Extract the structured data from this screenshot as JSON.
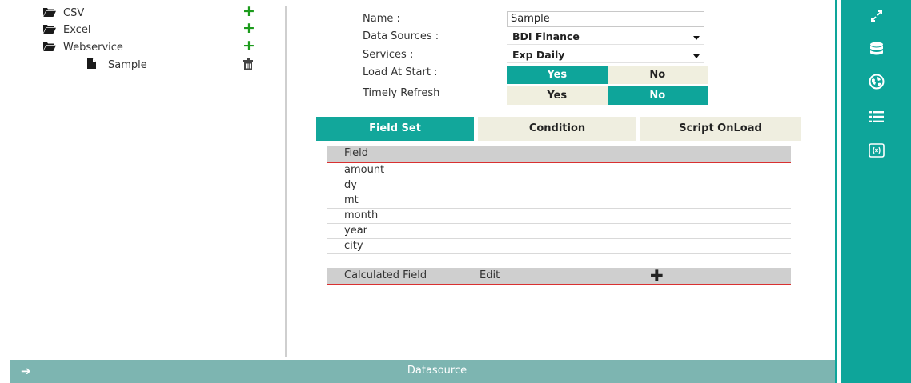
{
  "tree": {
    "items": [
      {
        "label": "CSV",
        "icon": "folder-open-icon",
        "action": "add-icon"
      },
      {
        "label": "Excel",
        "icon": "folder-open-icon",
        "action": "add-icon"
      },
      {
        "label": "Webservice",
        "icon": "folder-open-icon",
        "action": "add-icon"
      },
      {
        "label": "Sample",
        "icon": "file-icon",
        "action": "trash-icon"
      }
    ],
    "add_glyph": "+"
  },
  "form": {
    "name_label": "Name :",
    "name_value": "Sample",
    "data_sources_label": "Data Sources :",
    "data_sources_value": "BDI Finance",
    "services_label": "Services :",
    "services_value": "Exp Daily",
    "load_at_start_label": "Load At Start :",
    "load_at_start": {
      "yes": "Yes",
      "no": "No",
      "selected": "Yes"
    },
    "timely_refresh_label": "Timely Refresh",
    "timely_refresh": {
      "yes": "Yes",
      "no": "No",
      "selected": "No"
    }
  },
  "tabs": [
    {
      "label": "Field Set",
      "active": true
    },
    {
      "label": "Condition",
      "active": false
    },
    {
      "label": "Script OnLoad",
      "active": false
    }
  ],
  "field_table": {
    "header": "Field",
    "rows": [
      "amount",
      "dy",
      "mt",
      "month",
      "year",
      "city"
    ]
  },
  "calculated": {
    "title": "Calculated Field",
    "edit": "Edit",
    "add_glyph": "✚"
  },
  "bottom_bar": {
    "title": "Datasource",
    "arrow": "➔"
  },
  "sidebar": {
    "icons": [
      "expand-icon",
      "database-icon",
      "globe-icon",
      "list-icon",
      "formula-icon"
    ]
  },
  "colors": {
    "accent": "#0ea59a",
    "toggle_off": "#f0efdf",
    "header_gray": "#cfcfcf",
    "underline_red": "#d93030",
    "bottom_bar": "#7db5b1",
    "plus_green": "#1c9b1c"
  }
}
